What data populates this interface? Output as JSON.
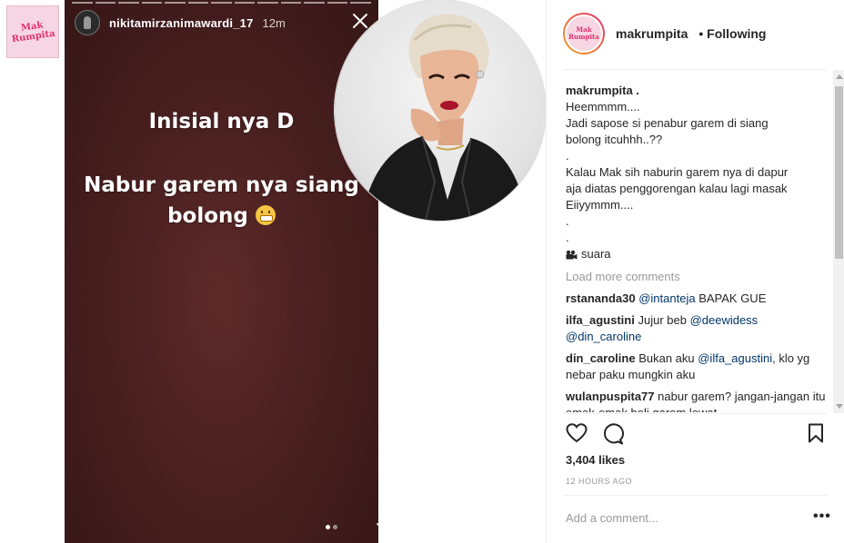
{
  "thumbnail": {
    "logo_text": "Mak\nRumpita"
  },
  "story": {
    "username": "nikitamirzanimawardi_17",
    "time": "12m",
    "text_line1": "Inisial nya D",
    "text_line2": "Nabur garem nya siang",
    "text_line3": "bolong",
    "progress_segments": 13
  },
  "post": {
    "username": "makrumpita",
    "follow_status": "• Following",
    "avatar_text": "Mak Rumpita",
    "caption": {
      "user": "makrumpita .",
      "lines": [
        "Heemmmm....",
        "Jadi sapose si penabur garem di siang",
        "bolong itcuhhh..??",
        ".",
        "Kalau Mak sih naburin garem nya di dapur",
        "aja diatas penggorengan kalau lagi masak",
        "Eiiyymmm....",
        ".",
        "."
      ],
      "audio_label": "suara"
    },
    "load_more": "Load more comments",
    "comments": [
      {
        "user": "rstananda30",
        "mention": "@intanteja",
        "text": " BAPAK GUE"
      },
      {
        "user": "ilfa_agustini",
        "text": " Jujur beb ",
        "mention": "@deewidess",
        "mention2": "@din_caroline"
      },
      {
        "user": "din_caroline",
        "text": " Bukan aku ",
        "mention": "@ilfa_agustini",
        "text2": ", klo yg nebar paku mungkin aku"
      },
      {
        "user": "wulanpuspita77",
        "text": " nabur garem? jangan-jangan itu emak-emak beli garem lewat"
      }
    ],
    "likes": "3,404 likes",
    "time_ago": "12 HOURS AGO",
    "add_comment_placeholder": "Add a comment...",
    "more_label": "•••"
  }
}
